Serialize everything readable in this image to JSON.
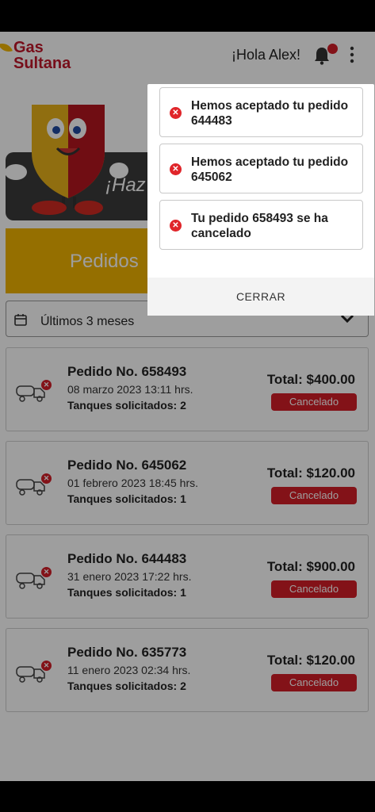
{
  "header": {
    "logo_line1": "Gas",
    "logo_line2": "Sultana",
    "greeting": "¡Hola Alex!"
  },
  "banner": {
    "text": "¡Haz"
  },
  "tabs": {
    "pedidos": "Pedidos"
  },
  "filter": {
    "selected": "Últimos 3 meses"
  },
  "orders": [
    {
      "title": "Pedido No. 658493",
      "date": "08 marzo 2023 13:11 hrs.",
      "tanks": "Tanques solicitados: 2",
      "total": "Total: $400.00",
      "status": "Cancelado"
    },
    {
      "title": "Pedido No. 645062",
      "date": "01 febrero 2023 18:45 hrs.",
      "tanks": "Tanques solicitados: 1",
      "total": "Total: $120.00",
      "status": "Cancelado"
    },
    {
      "title": "Pedido No. 644483",
      "date": "31 enero 2023 17:22 hrs.",
      "tanks": "Tanques solicitados: 1",
      "total": "Total: $900.00",
      "status": "Cancelado"
    },
    {
      "title": "Pedido No. 635773",
      "date": "11 enero 2023 02:34 hrs.",
      "tanks": "Tanques solicitados: 2",
      "total": "Total: $120.00",
      "status": "Cancelado"
    }
  ],
  "notifications": {
    "items": [
      {
        "text": "Hemos aceptado tu pedido 644483"
      },
      {
        "text": "Hemos aceptado tu pedido 645062"
      },
      {
        "text": "Tu pedido 658493 se ha cancelado"
      }
    ],
    "close_label": "CERRAR"
  },
  "colors": {
    "brand_red": "#c0182b",
    "brand_yellow": "#f0b400",
    "status_red": "#d41e28"
  },
  "icons": {
    "notification": "bell-icon",
    "menu": "kebab-menu-icon",
    "calendar": "calendar-icon",
    "dropdown": "chevron-down-icon",
    "order": "gas-truck-icon",
    "error": "x-circle-icon"
  }
}
